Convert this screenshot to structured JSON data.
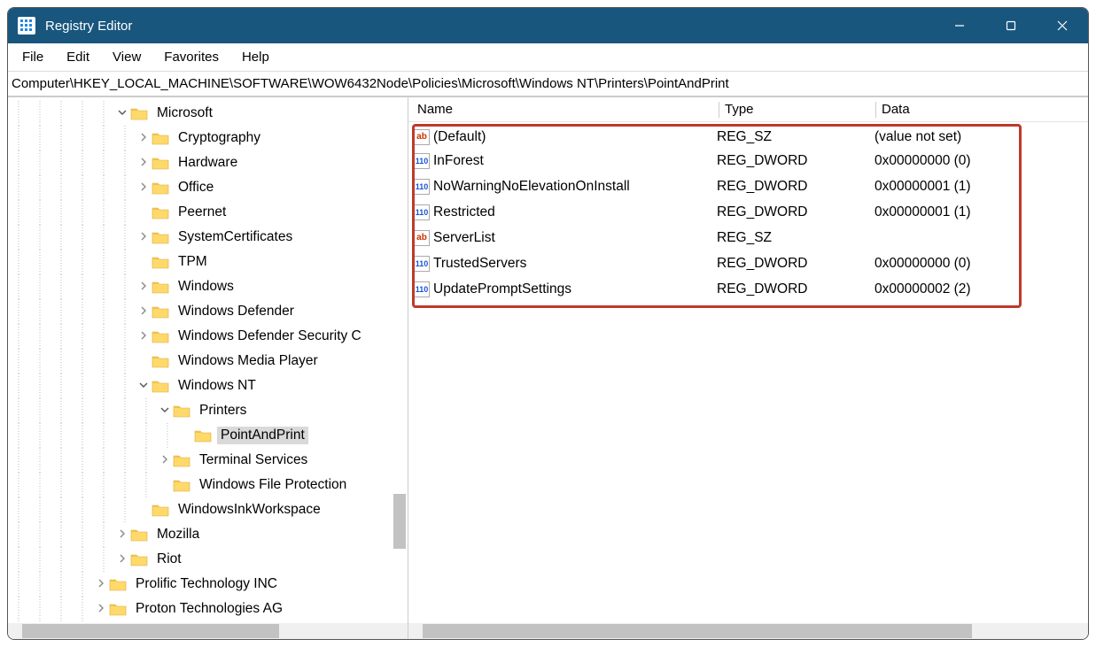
{
  "title": "Registry Editor",
  "menu": {
    "file": "File",
    "edit": "Edit",
    "view": "View",
    "favorites": "Favorites",
    "help": "Help"
  },
  "address": "Computer\\HKEY_LOCAL_MACHINE\\SOFTWARE\\WOW6432Node\\Policies\\Microsoft\\Windows NT\\Printers\\PointAndPrint",
  "tree": [
    {
      "depth": 5,
      "exp": "v",
      "label": "Microsoft"
    },
    {
      "depth": 6,
      "exp": ">",
      "label": "Cryptography"
    },
    {
      "depth": 6,
      "exp": ">",
      "label": "Hardware"
    },
    {
      "depth": 6,
      "exp": ">",
      "label": "Office"
    },
    {
      "depth": 6,
      "exp": " ",
      "label": "Peernet"
    },
    {
      "depth": 6,
      "exp": ">",
      "label": "SystemCertificates"
    },
    {
      "depth": 6,
      "exp": " ",
      "label": "TPM"
    },
    {
      "depth": 6,
      "exp": ">",
      "label": "Windows"
    },
    {
      "depth": 6,
      "exp": ">",
      "label": "Windows Defender"
    },
    {
      "depth": 6,
      "exp": ">",
      "label": "Windows Defender Security C"
    },
    {
      "depth": 6,
      "exp": " ",
      "label": "Windows Media Player"
    },
    {
      "depth": 6,
      "exp": "v",
      "label": "Windows NT"
    },
    {
      "depth": 7,
      "exp": "v",
      "label": "Printers"
    },
    {
      "depth": 8,
      "exp": " ",
      "label": "PointAndPrint",
      "selected": true
    },
    {
      "depth": 7,
      "exp": ">",
      "label": "Terminal Services"
    },
    {
      "depth": 7,
      "exp": " ",
      "label": "Windows File Protection"
    },
    {
      "depth": 6,
      "exp": " ",
      "label": "WindowsInkWorkspace"
    },
    {
      "depth": 5,
      "exp": ">",
      "label": "Mozilla"
    },
    {
      "depth": 5,
      "exp": ">",
      "label": "Riot"
    },
    {
      "depth": 4,
      "exp": ">",
      "label": "Prolific Technology INC"
    },
    {
      "depth": 4,
      "exp": ">",
      "label": "Proton Technologies AG"
    }
  ],
  "columns": {
    "name": "Name",
    "type": "Type",
    "data": "Data"
  },
  "values": [
    {
      "icon": "sz",
      "name": "(Default)",
      "type": "REG_SZ",
      "data": "(value not set)"
    },
    {
      "icon": "dw",
      "name": "InForest",
      "type": "REG_DWORD",
      "data": "0x00000000 (0)"
    },
    {
      "icon": "dw",
      "name": "NoWarningNoElevationOnInstall",
      "type": "REG_DWORD",
      "data": "0x00000001 (1)"
    },
    {
      "icon": "dw",
      "name": "Restricted",
      "type": "REG_DWORD",
      "data": "0x00000001 (1)"
    },
    {
      "icon": "sz",
      "name": "ServerList",
      "type": "REG_SZ",
      "data": ""
    },
    {
      "icon": "dw",
      "name": "TrustedServers",
      "type": "REG_DWORD",
      "data": "0x00000000 (0)"
    },
    {
      "icon": "dw",
      "name": "UpdatePromptSettings",
      "type": "REG_DWORD",
      "data": "0x00000002 (2)"
    }
  ]
}
